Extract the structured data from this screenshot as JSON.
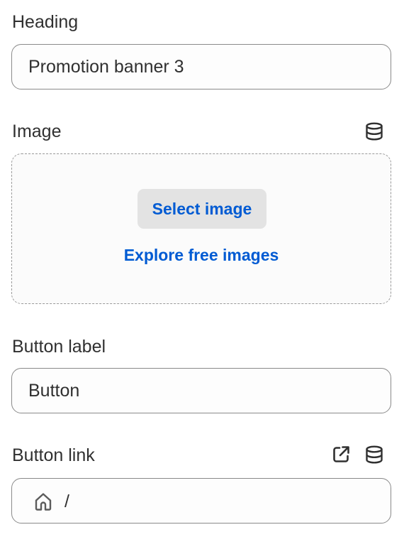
{
  "heading": {
    "label": "Heading",
    "value": "Promotion banner 3"
  },
  "image": {
    "label": "Image",
    "dynamic_source_icon": "database-icon",
    "select_button": "Select image",
    "explore_link": "Explore free images"
  },
  "button_label": {
    "label": "Button label",
    "value": "Button"
  },
  "button_link": {
    "label": "Button link",
    "open_icon": "external-link-icon",
    "dynamic_source_icon": "database-icon",
    "leading_icon": "home-icon",
    "value": "/"
  },
  "colors": {
    "text": "#303030",
    "link_blue": "#005bd3",
    "button_bg": "#e3e3e3",
    "border": "#8a8a8a"
  }
}
